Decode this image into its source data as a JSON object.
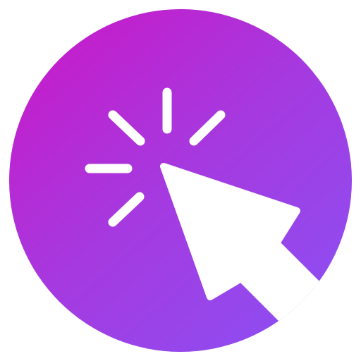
{
  "icon": {
    "name": "click-cursor-icon",
    "colors": {
      "gradient_start": "#c21fcc",
      "gradient_mid": "#a53ae0",
      "gradient_end": "#8f4cf0",
      "foreground": "#ffffff",
      "ring": "#ffffff"
    }
  }
}
